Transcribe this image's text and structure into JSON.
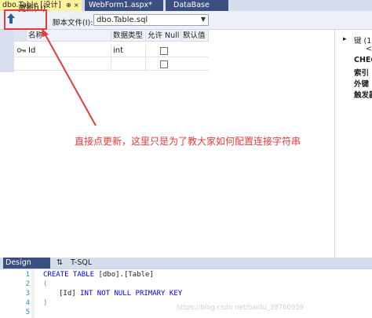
{
  "tabs": {
    "active": "dbo.Table [设计]",
    "pin_glyph": "⊕",
    "close_glyph": "×",
    "webform": "WebForm1.aspx*",
    "database": "DataBase"
  },
  "toolbar": {
    "update_label": "更新(U)",
    "script_label": "脚本文件(I):",
    "script_value": "dbo.Table.sql"
  },
  "grid": {
    "columns": [
      "名称",
      "数据类型",
      "允许 Null",
      "默认值"
    ],
    "rows": [
      {
        "name": "Id",
        "type": "int",
        "allow_null": false,
        "primary_key": true
      },
      {
        "name": "",
        "type": "",
        "allow_null": false,
        "primary_key": false
      }
    ]
  },
  "right_pane": {
    "items": [
      "键 (1)",
      "<",
      "CHEC",
      "索引",
      "外键",
      "触发器"
    ]
  },
  "annotation": "直接点更新，这里只是为了教大家如何配置连接字符串",
  "bottom_tabs": {
    "design": "Design",
    "swap_icon": "⇅",
    "tsql": "T-SQL"
  },
  "code": {
    "line_numbers": [
      "1",
      "2",
      "3",
      "4",
      "5"
    ],
    "line1_kw": "CREATE TABLE",
    "line1_rest": "[dbo].[Table]",
    "line2": "(",
    "line3_col": "[Id]",
    "line3_type": "INT NOT NULL PRIMARY KEY",
    "line4": ")"
  },
  "watermark": "https://blog.csdn.net/baidu_38760959",
  "colors": {
    "accent_red": "#e53b3b",
    "active_tab": "#fff29d",
    "dark_tab": "#3b4f81",
    "sql_keyword": "#0000ff"
  }
}
